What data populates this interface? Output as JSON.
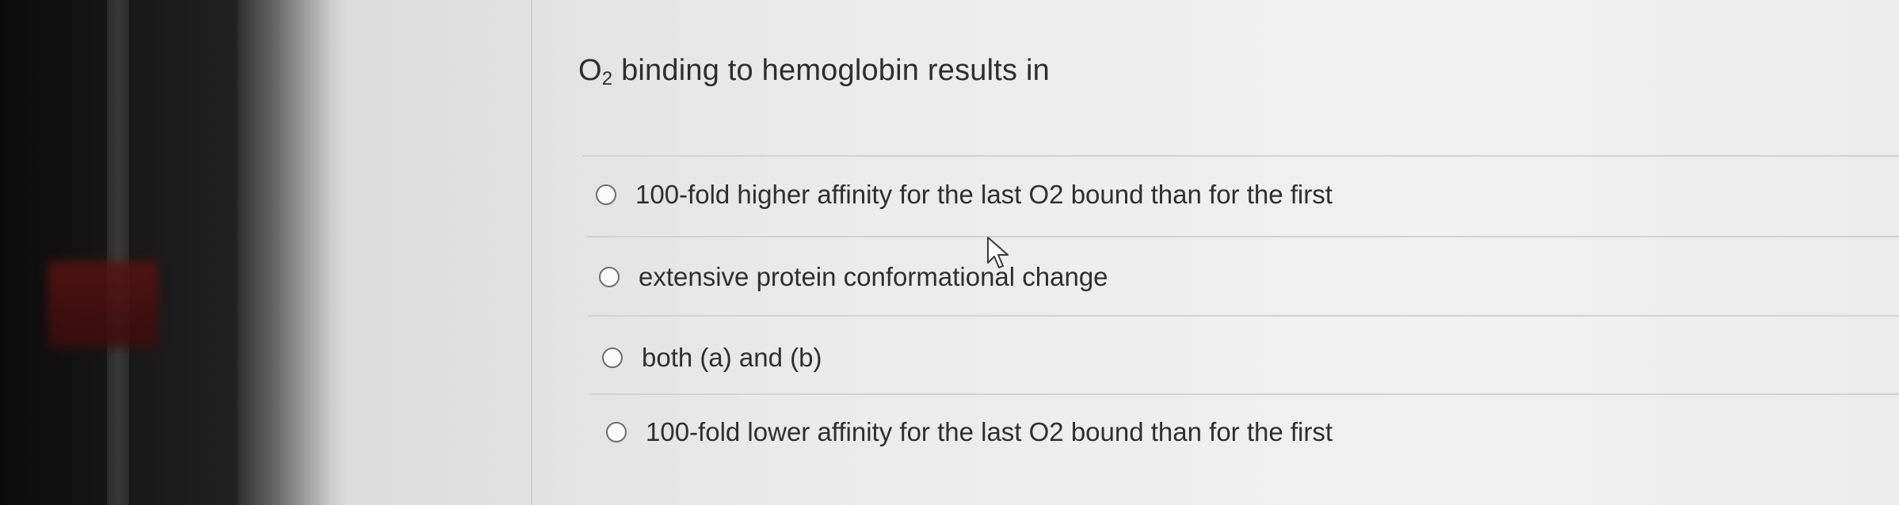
{
  "question": {
    "prefix": "O",
    "subscript": "2",
    "text": " binding to hemoglobin results in"
  },
  "options": [
    {
      "label": "100-fold higher affinity for the last O2 bound than for the first",
      "selected": false
    },
    {
      "label": "extensive protein conformational change",
      "selected": false
    },
    {
      "label": "both (a) and (b)",
      "selected": false
    },
    {
      "label": "100-fold lower affinity for the last O2 bound than for the first",
      "selected": false
    }
  ],
  "icons": {
    "radio": "radio-circle-icon",
    "cursor": "arrow-cursor-icon"
  },
  "colors": {
    "panel_background": "#ececec",
    "text": "#2f2f2f",
    "radio_border": "#6d6d6d",
    "divider": "#d2d2d2"
  }
}
